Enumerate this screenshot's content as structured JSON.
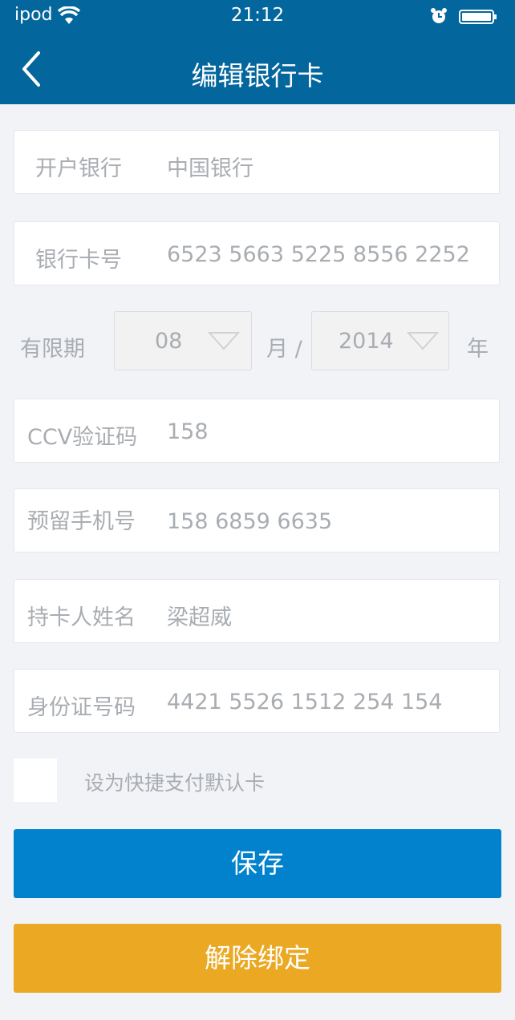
{
  "status_bar": {
    "carrier": "ipod",
    "time": "21:12"
  },
  "header": {
    "title": "编辑银行卡"
  },
  "form": {
    "bank": {
      "label": "开户银行",
      "value": "中国银行"
    },
    "card_number": {
      "label": "银行卡号",
      "value": "6523 5663 5225 8556 2252"
    },
    "expiry": {
      "label": "有限期",
      "month": "08",
      "month_unit": "月 /",
      "year": "2014",
      "year_unit": "年"
    },
    "ccv": {
      "label": "CCV验证码",
      "value": "158"
    },
    "phone": {
      "label": "预留手机号",
      "value": "158 6859 6635"
    },
    "holder": {
      "label": "持卡人姓名",
      "value": "梁超威"
    },
    "id_number": {
      "label": "身份证号码",
      "value": "4421 5526 1512 254 154"
    },
    "default_card": {
      "label": "设为快捷支付默认卡",
      "checked": false
    }
  },
  "buttons": {
    "save": "保存",
    "unbind": "解除绑定"
  },
  "colors": {
    "header": "#03669d",
    "save": "#0282cc",
    "unbind": "#eba822",
    "background": "#f1f3f6"
  },
  "icons": {
    "back": "chevron-left-icon",
    "wifi": "wifi-icon",
    "alarm": "alarm-icon",
    "battery": "battery-icon",
    "dropdown": "triangle-down-icon"
  }
}
